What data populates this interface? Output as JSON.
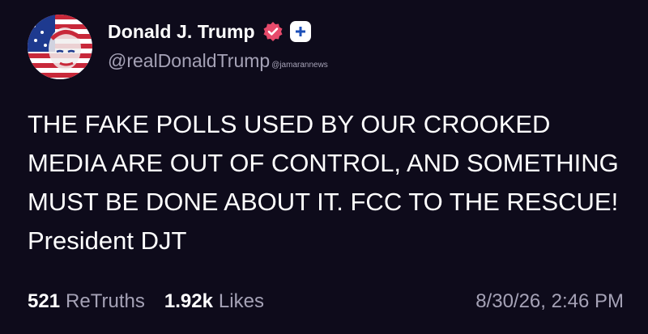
{
  "author": {
    "display_name": "Donald J. Trump",
    "handle": "@realDonaldTrump",
    "verified_icon": "verified-badge-icon",
    "follow_icon": "plus-icon",
    "avatar_icon": "flag-portrait-avatar"
  },
  "watermark": "@jamarannews",
  "post": {
    "text": "THE FAKE POLLS USED BY OUR CROOKED MEDIA ARE OUT OF CONTROL, AND SOMETHING MUST BE DONE ABOUT IT. FCC TO THE RESCUE! President DJT"
  },
  "stats": {
    "retruths_count": "521",
    "retruths_label": "ReTruths",
    "likes_count": "1.92k",
    "likes_label": "Likes",
    "timestamp": "8/30/26, 2:46 PM"
  },
  "colors": {
    "background": "#0e0b1b",
    "text_primary": "#ffffff",
    "text_secondary": "#a5a2b6",
    "verified_badge": "#e74a6b"
  }
}
